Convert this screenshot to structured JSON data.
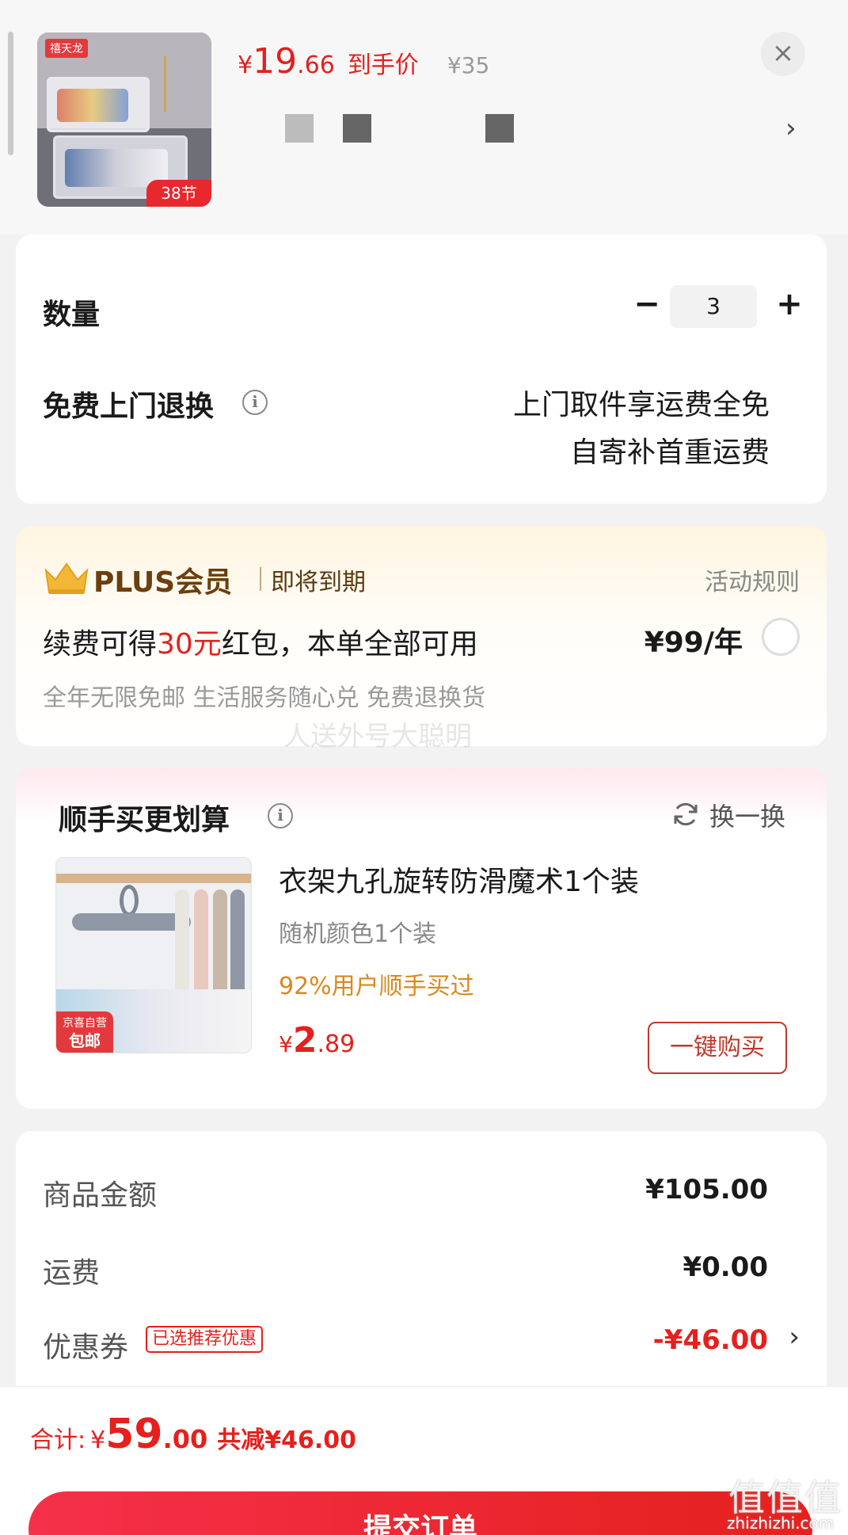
{
  "product": {
    "thumb_logo": "禧天龙",
    "thumb_tag": "38节",
    "price_yen": "¥",
    "price_int": "19",
    "price_dec": ".66",
    "price_label": "到手价",
    "original_price": "¥35",
    "close_icon": "×",
    "spec_chevron": "›"
  },
  "quantity": {
    "label": "数量",
    "minus": "−",
    "value": "3",
    "plus": "+"
  },
  "returns": {
    "label": "免费上门退换",
    "info": "i",
    "line1": "上门取件享运费全免",
    "line2": "自寄补首重运费"
  },
  "plus": {
    "title": "PLUS会员",
    "expire": "即将到期",
    "rules": "活动规则",
    "line_prefix": "续费可得",
    "line_highlight": "30元",
    "line_suffix": "红包，本单全部可用",
    "price": "¥99/年",
    "sub": "全年无限免邮 生活服务随心兑 免费退换货",
    "watermark": "人送外号大聪明"
  },
  "addon": {
    "title": "顺手买更划算",
    "info": "i",
    "refresh": "换一换",
    "badge_top": "京喜自营",
    "badge_bottom": "包邮",
    "name": "衣架九孔旋转防滑魔术1个装",
    "spec": "随机颜色1个装",
    "popularity": "92%用户顺手买过",
    "price_yen": "¥",
    "price_int": "2",
    "price_dec": ".89",
    "buy": "一键购买"
  },
  "summary": {
    "goods_label": "商品金额",
    "goods_value": "¥105.00",
    "shipping_label": "运费",
    "shipping_value": "¥0.00",
    "coupon_label": "优惠券",
    "coupon_tag": "已选推荐优惠",
    "coupon_value": "-¥46.00",
    "coupon_chevron": "›"
  },
  "bottom": {
    "total_label": "合计:",
    "total_yen": "¥",
    "total_int": "59",
    "total_dec": ".00",
    "total_saving": "共减¥46.00",
    "submit": "提交订单",
    "site_mark": "值值值",
    "site_url": "zhizhizhi.com"
  },
  "colors": {
    "accent_red": "#e5201d",
    "plus_gold": "#6b3f0e",
    "popularity_orange": "#d9891e"
  }
}
